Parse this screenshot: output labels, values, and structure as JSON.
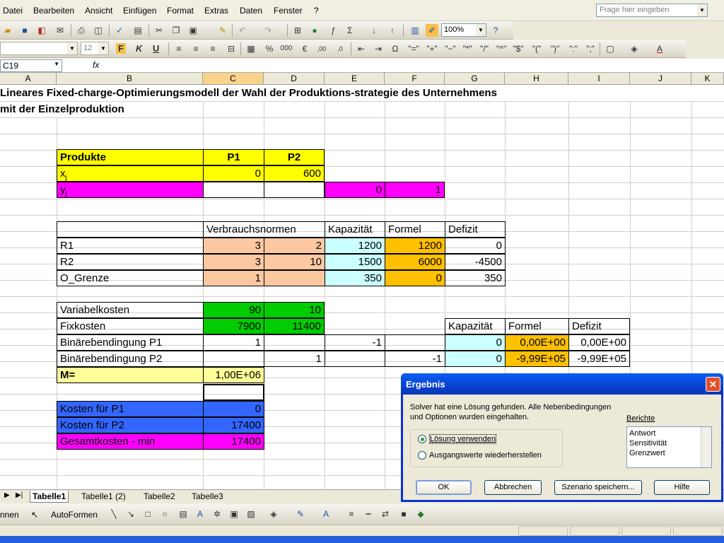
{
  "menu": [
    "Datei",
    "Bearbeiten",
    "Ansicht",
    "Einfügen",
    "Format",
    "Extras",
    "Daten",
    "Fenster",
    "?"
  ],
  "help_placeholder": "Frage hier eingeben",
  "zoom": "100%",
  "font_size": "12",
  "namebox": "C19",
  "fx_label": "fx",
  "columns": [
    "A",
    "B",
    "C",
    "D",
    "E",
    "F",
    "G",
    "H",
    "I",
    "J",
    "K"
  ],
  "title_line1": "Lineares Fixed-charge-Optimierungsmodell der Wahl der Produktions-strategie des Unternehmens",
  "title_line2": "mit der Einzelproduktion",
  "products": {
    "header": "Produkte",
    "p1": "P1",
    "p2": "P2",
    "xj": "x",
    "xj_sub": "j",
    "x1": "0",
    "x2": "600",
    "yj": "y",
    "yj_sub": "j",
    "y1": "0",
    "y2": "1"
  },
  "norms": {
    "h_verbrauch": "Verbrauchsnormen",
    "h_kap": "Kapazität",
    "h_formel": "Formel",
    "h_defizit": "Defizit",
    "rows": [
      {
        "label": "R1",
        "c": "3",
        "d": "2",
        "kap": "1200",
        "formel": "1200",
        "defizit": "0"
      },
      {
        "label": "R2",
        "c": "3",
        "d": "10",
        "kap": "1500",
        "formel": "6000",
        "defizit": "-4500"
      },
      {
        "label": "O_Grenze",
        "c": "1",
        "d": "",
        "kap": "350",
        "formel": "0",
        "defizit": "350"
      }
    ]
  },
  "costs": {
    "var_label": "Variabelkosten",
    "var_c": "90",
    "var_d": "10",
    "fix_label": "Fixkosten",
    "fix_c": "7900",
    "fix_d": "11400",
    "bin1_label": "Binärebendingung P1",
    "bin1_c": "1",
    "bin1_e": "-1",
    "bin2_label": "Binärebendingung P2",
    "bin2_d": "1",
    "bin2_f": "-1",
    "m_label": "M=",
    "m_value": "1,00E+06",
    "h_kap": "Kapazität",
    "h_formel": "Formel",
    "h_defizit": "Defizit",
    "b1_kap": "0",
    "b1_formel": "0,00E+00",
    "b1_defizit": "0,00E+00",
    "b2_kap": "0",
    "b2_formel": "-9,99E+05",
    "b2_defizit": "-9,99E+05"
  },
  "results": {
    "k1_label": "Kosten für P1",
    "k1": "0",
    "k2_label": "Kosten für P2",
    "k2": "17400",
    "total_label": "Gesamtkosten - min",
    "total": "17400"
  },
  "tabs": [
    "Tabelle1",
    "Tabelle1 (2)",
    "Tabelle2",
    "Tabelle3"
  ],
  "drawbar": {
    "zeichnen": "nnen",
    "autoformen": "AutoFormen"
  },
  "dialog": {
    "title": "Ergebnis",
    "message1": "Solver hat eine Lösung gefunden. Alle Nebenbedingungen",
    "message2": "und Optionen wurden eingehalten.",
    "radio1": "Lösung verwenden",
    "radio2": "Ausgangswerte wiederherstellen",
    "reports_label": "Berichte",
    "reports": [
      "Antwort",
      "Sensitivität",
      "Grenzwert"
    ],
    "ok": "OK",
    "cancel": "Abbrechen",
    "save_scenario": "Szenario speichern...",
    "help": "Hilfe"
  },
  "colors": {
    "yellow": "#ffff00",
    "magenta": "#ff00ff",
    "peach": "#fbc8a2",
    "lightcyan": "#ccffff",
    "orange": "#ffc000",
    "green": "#00cc00",
    "lightyellow": "#ffff99",
    "blue": "#3366ff"
  }
}
